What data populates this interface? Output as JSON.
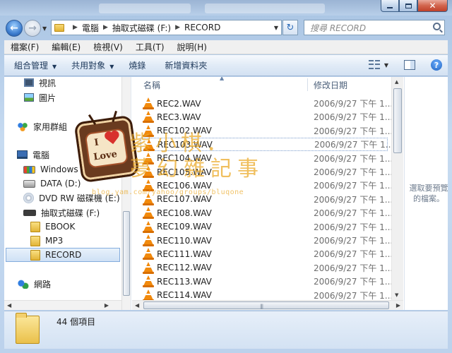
{
  "window": {
    "close_glyph": "✕"
  },
  "nav": {
    "back_glyph": "←",
    "forward_glyph": "→",
    "refresh_glyph": "↻"
  },
  "address": {
    "crumbs": [
      "電腦",
      "抽取式磁碟 (F:)",
      "RECORD"
    ]
  },
  "search": {
    "placeholder": "搜尋 RECORD"
  },
  "menu": [
    "檔案(F)",
    "編輯(E)",
    "檢視(V)",
    "工具(T)",
    "說明(H)"
  ],
  "commands": {
    "organize": "組合管理",
    "share": "共用對象",
    "burn": "燒錄",
    "new_folder": "新增資料夾"
  },
  "navpane": {
    "items": [
      {
        "label": "視訊",
        "icon": "video-library-icon"
      },
      {
        "label": "圖片",
        "icon": "pictures-library-icon"
      },
      {
        "label": "家用群組",
        "icon": "homegroup-icon"
      },
      {
        "label": "電腦",
        "icon": "computer-icon"
      },
      {
        "label": "Windows (C:)",
        "icon": "windows-drive-icon"
      },
      {
        "label": "DATA (D:)",
        "icon": "hard-drive-icon"
      },
      {
        "label": "DVD RW 磁碟機 (E:) Au",
        "icon": "dvd-drive-icon"
      },
      {
        "label": "抽取式磁碟 (F:)",
        "icon": "removable-drive-icon"
      },
      {
        "label": "EBOOK",
        "icon": "folder-icon"
      },
      {
        "label": "MP3",
        "icon": "folder-icon"
      },
      {
        "label": "RECORD",
        "icon": "folder-icon",
        "selected": true
      },
      {
        "label": "網路",
        "icon": "network-icon"
      }
    ]
  },
  "filelist": {
    "columns": {
      "name": "名稱",
      "date": "修改日期"
    },
    "files": [
      {
        "name": "REC2.WAV",
        "date": "2006/9/27 下午 1..."
      },
      {
        "name": "REC3.WAV",
        "date": "2006/9/27 下午 1..."
      },
      {
        "name": "REC102.WAV",
        "date": "2006/9/27 下午 1..."
      },
      {
        "name": "REC103.WAV",
        "date": "2006/9/27 下午 1..."
      },
      {
        "name": "REC104.WAV",
        "date": "2006/9/27 下午 1..."
      },
      {
        "name": "REC105.WAV",
        "date": "2006/9/27 下午 1..."
      },
      {
        "name": "REC106.WAV",
        "date": "2006/9/27 下午 1..."
      },
      {
        "name": "REC107.WAV",
        "date": "2006/9/27 下午 1..."
      },
      {
        "name": "REC108.WAV",
        "date": "2006/9/27 下午 1..."
      },
      {
        "name": "REC109.WAV",
        "date": "2006/9/27 下午 1..."
      },
      {
        "name": "REC110.WAV",
        "date": "2006/9/27 下午 1..."
      },
      {
        "name": "REC111.WAV",
        "date": "2006/9/27 下午 1..."
      },
      {
        "name": "REC112.WAV",
        "date": "2006/9/27 下午 1..."
      },
      {
        "name": "REC113.WAV",
        "date": "2006/9/27 下午 1..."
      },
      {
        "name": "REC114.WAV",
        "date": "2006/9/27 下午 1..."
      }
    ]
  },
  "preview": {
    "text": "選取要預覽的檔案。"
  },
  "status": {
    "count": "44 個項目"
  },
  "watermark": {
    "title_line1": "紫小棋．",
    "title_line2": "夢幻雜記事",
    "url": "blog.yam.com/yahoo/groups/bluqone",
    "badge_top": "I",
    "badge_text": "Love"
  },
  "colors": {
    "accent": "#3f7fd0",
    "vlc_orange": "#f28a0c",
    "watermark": "#ebaa28"
  }
}
